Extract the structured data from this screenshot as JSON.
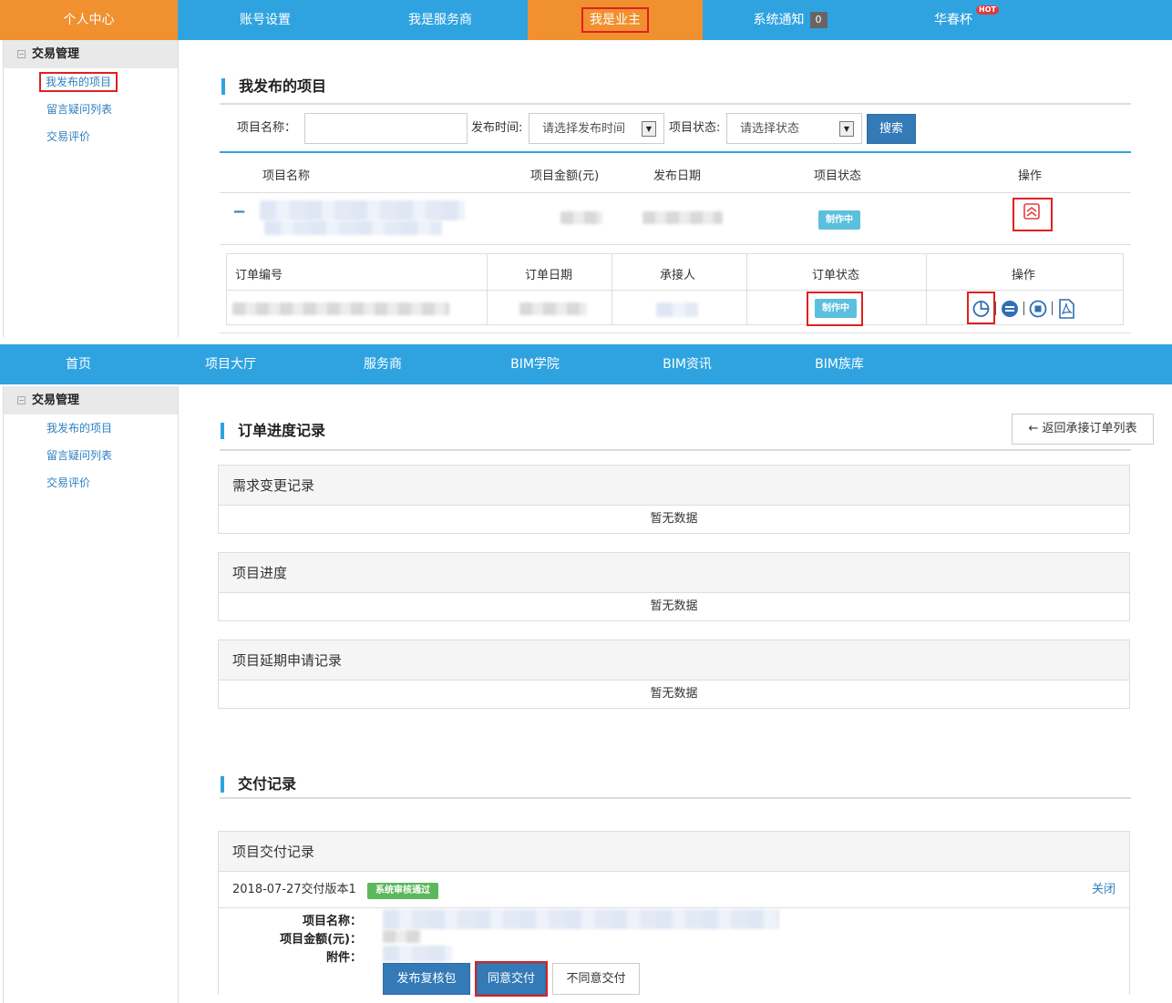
{
  "top_nav": {
    "personal_center": "个人中心",
    "account_settings": "账号设置",
    "service_provider": "我是服务商",
    "owner": "我是业主",
    "notifications": "系统通知",
    "notification_count": "0",
    "huachun_cup": "华春杯",
    "hot_badge": "HOT"
  },
  "sidebar": {
    "group": "交易管理",
    "items": [
      "我发布的项目",
      "留言疑问列表",
      "交易评价"
    ]
  },
  "my_projects": {
    "title": "我发布的项目",
    "filters": {
      "name_label": "项目名称：",
      "time_label": "发布时间:",
      "time_placeholder": "请选择发布时间",
      "status_label": "项目状态:",
      "status_placeholder": "请选择状态",
      "search_button": "搜索"
    },
    "columns": [
      "项目名称",
      "项目金额(元)",
      "发布日期",
      "项目状态",
      "操作"
    ],
    "row_status": "制作中",
    "expand_symbol": "−",
    "orders": {
      "columns": [
        "订单编号",
        "订单日期",
        "承接人",
        "订单状态",
        "操作"
      ],
      "row_status": "制作中"
    }
  },
  "main_nav": {
    "items": [
      "首页",
      "项目大厅",
      "服务商",
      "BIM学院",
      "BIM资讯",
      "BIM族库"
    ]
  },
  "order_progress": {
    "title": "订单进度记录",
    "back_button": "← 返回承接订单列表",
    "panels": [
      {
        "title": "需求变更记录",
        "empty": "暂无数据"
      },
      {
        "title": "项目进度",
        "empty": "暂无数据"
      },
      {
        "title": "项目延期申请记录",
        "empty": "暂无数据"
      }
    ]
  },
  "delivery": {
    "title": "交付记录",
    "panel_title": "项目交付记录",
    "version": "2018-07-27交付版本1",
    "version_status": "系统审核通过",
    "close_link": "关闭",
    "labels": {
      "name": "项目名称：",
      "amount": "项目金额(元)：",
      "attachment": "附件："
    },
    "buttons": {
      "publish_review": "发布复核包",
      "agree": "同意交付",
      "disagree": "不同意交付"
    }
  },
  "colors": {
    "nav_blue": "#2fa3e0",
    "nav_orange": "#f0902f",
    "status_cyan": "#5bc0de",
    "approved_green": "#5cb85c",
    "highlight_red": "#e02020"
  }
}
